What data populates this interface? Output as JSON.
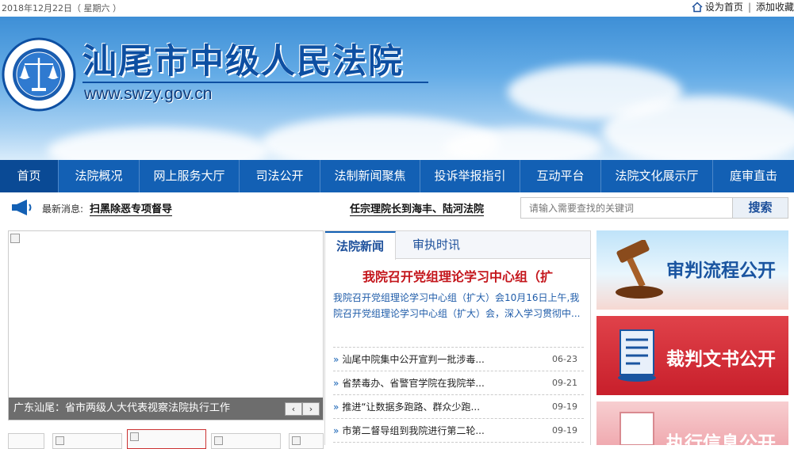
{
  "topbar": {
    "date": "2018年12月22日（  星期六  ）",
    "set_home": "设为首页",
    "separator": "|",
    "add_favorite": "添加收藏"
  },
  "banner": {
    "title": "汕尾市中级人民法院",
    "url": "www.swzy.gov.cn"
  },
  "nav": {
    "items": [
      {
        "label": "首页"
      },
      {
        "label": "法院概况"
      },
      {
        "label": "网上服务大厅"
      },
      {
        "label": "司法公开"
      },
      {
        "label": "法制新闻聚焦"
      },
      {
        "label": "投诉举报指引"
      },
      {
        "label": "互动平台"
      },
      {
        "label": "法院文化展示厅"
      },
      {
        "label": "庭审直击"
      }
    ]
  },
  "ticker": {
    "label": "最新消息:",
    "news": [
      "扫黑除恶专项督导",
      "任宗理院长到海丰、陆河法院"
    ]
  },
  "search": {
    "placeholder": "请输入需要查找的关键词",
    "button": "搜索"
  },
  "slider": {
    "caption": "广东汕尾：省市两级人大代表视察法院执行工作",
    "prev": "‹",
    "next": "›"
  },
  "news": {
    "tabs": [
      "法院新闻",
      "审执时讯"
    ],
    "headline": "我院召开党组理论学习中心组（扩",
    "summary": "我院召开党组理论学习中心组（扩大）会10月16日上午,我院召开党组理论学习中心组（扩大）会，深入学习贯彻中...",
    "items": [
      {
        "title": "汕尾中院集中公开宣判一批涉毒...",
        "date": "06-23"
      },
      {
        "title": "省禁毒办、省警官学院在我院举...",
        "date": "09-21"
      },
      {
        "title": "推进“让数据多跑路、群众少跑...",
        "date": "09-19"
      },
      {
        "title": "市第二督导组到我院进行第二轮...",
        "date": "09-19"
      }
    ]
  },
  "cards": [
    {
      "title": "审判流程公开"
    },
    {
      "title": "裁判文书公开"
    },
    {
      "title": "执行信息公开"
    }
  ],
  "colors": {
    "nav_bg": "#1360b4",
    "title_blue": "#0d4fa2",
    "headline_red": "#c4161c"
  }
}
